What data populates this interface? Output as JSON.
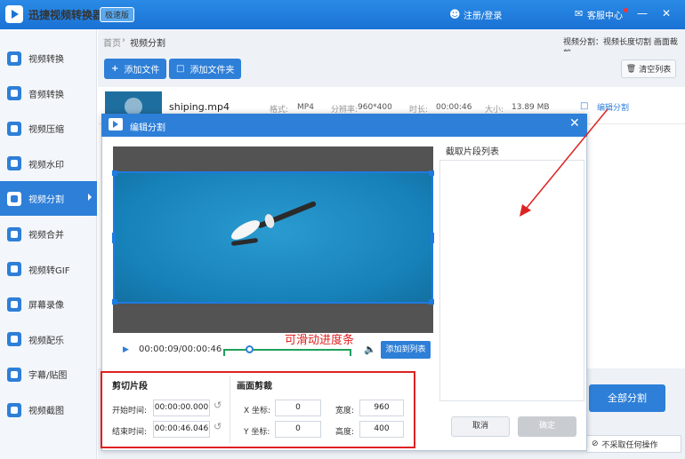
{
  "app": {
    "title": "迅捷视频转换器",
    "edition": "极速版",
    "login": "注册/登录",
    "service": "客服中心",
    "win_min": "—",
    "win_close": "✕"
  },
  "sidebar": {
    "items": [
      {
        "label": "视频转换",
        "icon": "video-convert-icon"
      },
      {
        "label": "音频转换",
        "icon": "audio-convert-icon"
      },
      {
        "label": "视频压缩",
        "icon": "video-compress-icon"
      },
      {
        "label": "视频水印",
        "icon": "watermark-icon"
      },
      {
        "label": "视频分割",
        "icon": "video-split-icon",
        "active": true
      },
      {
        "label": "视频合并",
        "icon": "video-merge-icon"
      },
      {
        "label": "视频转GIF",
        "icon": "gif-icon"
      },
      {
        "label": "屏幕录像",
        "icon": "screen-record-icon"
      },
      {
        "label": "视频配乐",
        "icon": "music-icon"
      },
      {
        "label": "字幕/贴图",
        "icon": "subtitle-icon"
      },
      {
        "label": "视频截图",
        "icon": "screenshot-icon"
      }
    ]
  },
  "breadcrumb": {
    "home": "首页",
    "sep": "›",
    "current": "视频分割",
    "right": "视频分割：视频长度切割 画面裁剪"
  },
  "toolbar": {
    "add_file": "添加文件",
    "add_folder": "添加文件夹",
    "clear": "清空列表"
  },
  "file": {
    "name": "shiping.mp4",
    "format_label": "格式:",
    "format": "MP4",
    "res_label": "分辨率:",
    "res": "960*400",
    "dur_label": "时长:",
    "dur": "00:00:46",
    "size_label": "大小:",
    "size": "13.89 MB",
    "edit_split": "编辑分割"
  },
  "footer": {
    "all_split": "全部分割",
    "no_action": "不采取任何操作"
  },
  "dialog": {
    "title": "编辑分割",
    "close": "✕",
    "time": "00:00:09/00:00:46",
    "progress": 0.2,
    "annotation": "可滑动进度条",
    "add_to_list": "添加到列表",
    "list_label": "截取片段列表",
    "cancel": "取消",
    "confirm": "确定",
    "clip": {
      "title": "剪切片段",
      "start_label": "开始时间:",
      "start": "00:00:00.000",
      "end_label": "结束时间:",
      "end": "00:00:46.046"
    },
    "crop": {
      "title": "画面剪裁",
      "x_label": "X 坐标:",
      "x": "0",
      "y_label": "Y 坐标:",
      "y": "0",
      "w_label": "宽度:",
      "w": "960",
      "h_label": "高度:",
      "h": "400"
    }
  },
  "colors": {
    "accent": "#2d7fd8",
    "annotation": "#e02020",
    "slider": "#1ea05a"
  }
}
